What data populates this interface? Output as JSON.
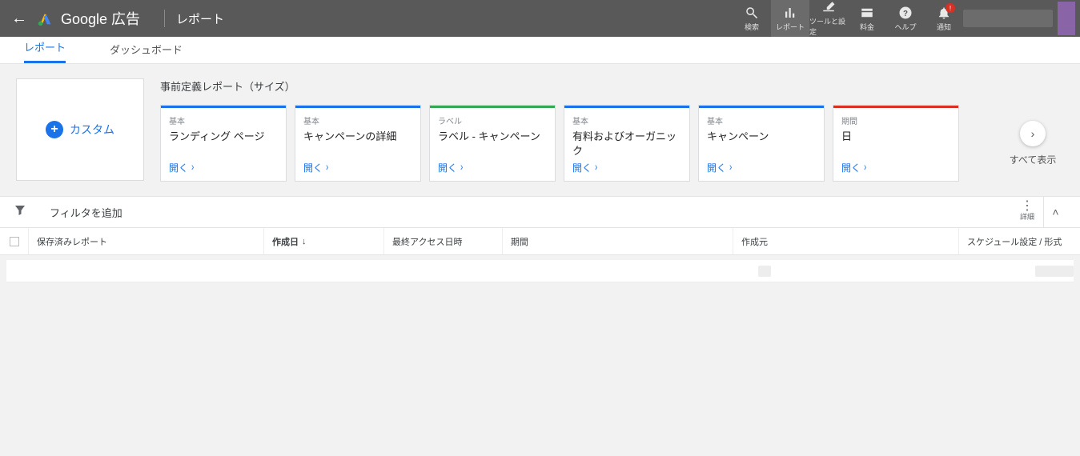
{
  "header": {
    "brand": "Google 広告",
    "crumb": "レポート",
    "icons": {
      "search": "検索",
      "reports": "レポート",
      "tools": "ツールと設定",
      "billing": "料金",
      "help": "ヘルプ",
      "notif": "通知",
      "notif_badge": "!"
    }
  },
  "tabs": {
    "reports": "レポート",
    "dashboards": "ダッシュボード"
  },
  "custom_button": "カスタム",
  "predef": {
    "title": "事前定義レポート（サイズ）",
    "show_all": "すべて表示",
    "cards": [
      {
        "cat": "基本",
        "title": "ランディング ページ",
        "stripe": "c-blue",
        "open": "開く"
      },
      {
        "cat": "基本",
        "title": "キャンペーンの詳細",
        "stripe": "c-blue",
        "open": "開く"
      },
      {
        "cat": "ラベル",
        "title": "ラベル - キャンペーン",
        "stripe": "c-green",
        "open": "開く"
      },
      {
        "cat": "基本",
        "title": "有料およびオーガニック",
        "stripe": "c-blue",
        "open": "開く"
      },
      {
        "cat": "基本",
        "title": "キャンペーン",
        "stripe": "c-blue",
        "open": "開く"
      },
      {
        "cat": "期間",
        "title": "日",
        "stripe": "c-red",
        "open": "開く"
      }
    ]
  },
  "filter": {
    "add": "フィルタを追加",
    "details": "詳細"
  },
  "table": {
    "cols": {
      "saved": "保存済みレポート",
      "created": "作成日",
      "access": "最終アクセス日時",
      "period": "期間",
      "creator": "作成元",
      "sched": "スケジュール設定 / 形式"
    }
  }
}
